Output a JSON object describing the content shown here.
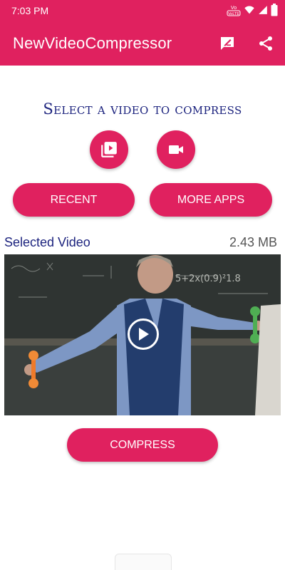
{
  "status_bar": {
    "time": "7:03 PM",
    "network_badge": "VoLTE",
    "icons": [
      "volte-icon",
      "wifi-icon",
      "signal-icon",
      "battery-icon"
    ]
  },
  "app_bar": {
    "title": "NewVideoCompressor",
    "actions": [
      "feedback-icon",
      "share-icon"
    ]
  },
  "main": {
    "headline": "Select a video to compress",
    "pick_buttons": [
      "video-library-icon",
      "videocam-icon"
    ],
    "recent_label": "RECENT",
    "more_apps_label": "MORE APPS",
    "selected_label": "Selected Video",
    "file_size": "2.43 MB",
    "compress_label": "COMPRESS"
  },
  "colors": {
    "accent": "#e0215f",
    "headline": "#1c237e",
    "text_secondary": "#555555"
  }
}
